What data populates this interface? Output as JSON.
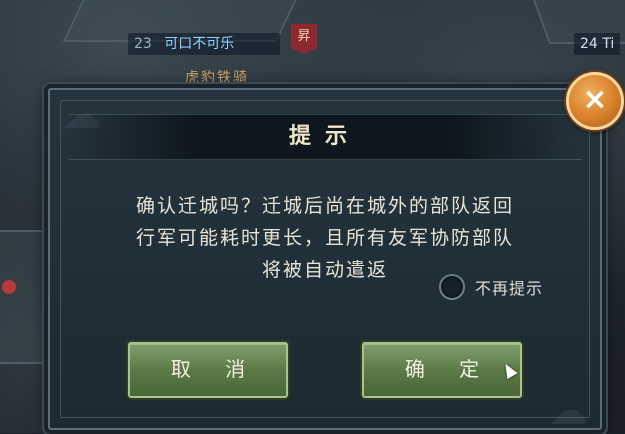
{
  "map": {
    "city_left_level": "23",
    "city_left_name": "可口不可乐",
    "city_right_level": "24 Ti",
    "banner_char": "昇",
    "unit_label": "虎豹铁骑"
  },
  "dialog": {
    "title": "提示",
    "message_lines": [
      "确认迁城吗？迁城后尚在城外的部队返回",
      "行军可能耗时更长，且所有友军协防部队",
      "将被自动遣返"
    ],
    "dont_remind_label": "不再提示",
    "cancel_label": "取 消",
    "confirm_label": "确 定",
    "close_glyph": "×"
  },
  "colors": {
    "button_green": "#5c7a48",
    "close_orange": "#d87f2a",
    "title_text": "#f1e7c8"
  }
}
